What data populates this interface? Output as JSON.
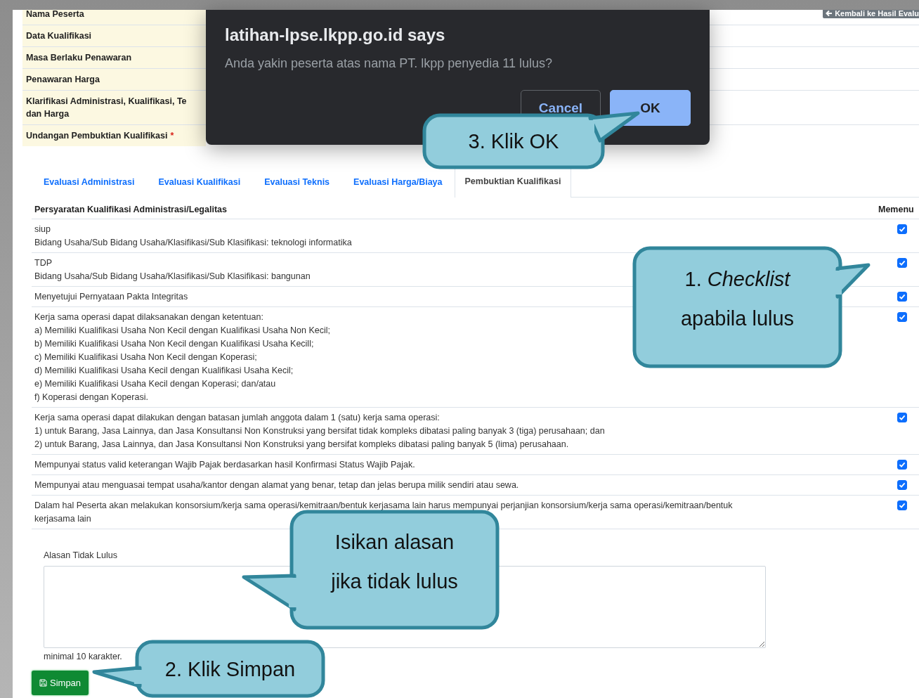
{
  "back_button": {
    "label": "Kembali ke Hasil Evalu"
  },
  "info_rows": [
    {
      "lines": [
        "Nama Peserta"
      ]
    },
    {
      "lines": [
        "Data Kualifikasi"
      ]
    },
    {
      "lines": [
        "Masa Berlaku Penawaran"
      ]
    },
    {
      "lines": [
        "Penawaran Harga"
      ]
    },
    {
      "lines": [
        "Klarifikasi Administrasi, Kualifikasi, Te",
        "dan Harga"
      ]
    },
    {
      "lines": [
        "Undangan Pembuktian Kualifikasi"
      ],
      "required_mark": "*"
    }
  ],
  "tabs": [
    {
      "label": "Evaluasi Administrasi",
      "selected": false
    },
    {
      "label": "Evaluasi Kualifikasi",
      "selected": false
    },
    {
      "label": "Evaluasi Teknis",
      "selected": false
    },
    {
      "label": "Evaluasi Harga/Biaya",
      "selected": false
    },
    {
      "label": "Pembuktian Kualifikasi",
      "selected": true
    }
  ],
  "requirements": {
    "columns": [
      "Persyaratan Kualifikasi Administrasi/Legalitas",
      "Memenu"
    ],
    "rows": [
      {
        "text": "siup\nBidang Usaha/Sub Bidang Usaha/Klasifikasi/Sub Klasifikasi: teknologi informatika",
        "checked": true
      },
      {
        "text": "TDP\nBidang Usaha/Sub Bidang Usaha/Klasifikasi/Sub Klasifikasi: bangunan",
        "checked": true
      },
      {
        "text": "Menyetujui Pernyataan Pakta Integritas",
        "checked": true
      },
      {
        "text": "Kerja sama operasi dapat dilaksanakan dengan ketentuan:\na) Memiliki Kualifikasi Usaha Non Kecil dengan Kualifikasi Usaha Non Kecil;\nb) Memiliki Kualifikasi Usaha Non Kecil dengan Kualifikasi Usaha Kecill;\nc) Memiliki Kualifikasi Usaha Non Kecil dengan Koperasi;\nd) Memiliki Kualifikasi Usaha Kecil dengan Kualifikasi Usaha Kecil;\ne) Memiliki Kualifikasi Usaha Kecil dengan Koperasi; dan/atau\nf) Koperasi dengan Koperasi.",
        "checked": true
      },
      {
        "text": "Kerja sama operasi dapat dilakukan dengan batasan jumlah anggota dalam 1 (satu) kerja sama operasi:\n1) untuk Barang, Jasa Lainnya, dan Jasa Konsultansi Non Konstruksi yang bersifat tidak kompleks dibatasi paling banyak 3 (tiga) perusahaan; dan\n2) untuk Barang, Jasa Lainnya, dan Jasa Konsultansi Non Konstruksi yang bersifat kompleks dibatasi paling banyak 5 (lima) perusahaan.",
        "checked": true
      },
      {
        "text": "Mempunyai status valid keterangan Wajib Pajak berdasarkan hasil Konfirmasi Status Wajib Pajak.",
        "checked": true
      },
      {
        "text": "Mempunyai atau menguasai tempat usaha/kantor dengan alamat yang benar, tetap dan jelas berupa milik sendiri atau sewa.",
        "checked": true
      },
      {
        "text": "Dalam hal Peserta akan melakukan konsorsium/kerja sama operasi/kemitraan/bentuk kerjasama lain harus mempunyai perjanjian konsorsium/kerja sama operasi/kemitraan/bentuk\nkerjasama lain",
        "checked": true
      }
    ]
  },
  "reason": {
    "label": "Alasan Tidak Lulus",
    "hint": "minimal 10 karakter."
  },
  "save_button": {
    "label": "Simpan"
  },
  "dialog": {
    "title": "latihan-lpse.lkpp.go.id says",
    "message": "Anda yakin peserta atas nama PT. lkpp penyedia 11 lulus?",
    "buttons": [
      {
        "label": "Cancel",
        "kind": "secondary"
      },
      {
        "label": "OK",
        "kind": "primary"
      }
    ]
  },
  "callouts": [
    {
      "text": "1. *Checklist*\napabila lulus"
    },
    {
      "text": "2. Klik Simpan"
    },
    {
      "text": "3. Klik OK"
    },
    {
      "text": "Isikan alasan\njika tidak lulus"
    }
  ]
}
